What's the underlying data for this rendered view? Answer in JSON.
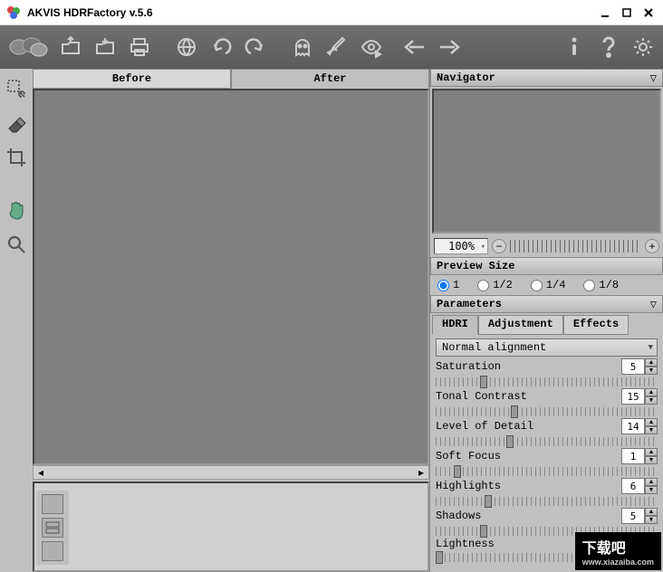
{
  "window": {
    "title": "AKVIS HDRFactory v.5.6"
  },
  "tabs": {
    "before": "Before",
    "after": "After"
  },
  "navigator": {
    "title": "Navigator",
    "zoom": "100%"
  },
  "preview": {
    "title": "Preview Size",
    "opts": {
      "o1": "1",
      "o2": "1/2",
      "o4": "1/4",
      "o8": "1/8"
    }
  },
  "parameters": {
    "title": "Parameters",
    "tabs": {
      "hdri": "HDRI",
      "adjustment": "Adjustment",
      "effects": "Effects"
    },
    "alignment": "Normal alignment",
    "rows": [
      {
        "label": "Saturation",
        "value": 5,
        "pos": 20
      },
      {
        "label": "Tonal Contrast",
        "value": 15,
        "pos": 34
      },
      {
        "label": "Level of Detail",
        "value": 14,
        "pos": 32
      },
      {
        "label": "Soft Focus",
        "value": 1,
        "pos": 8
      },
      {
        "label": "Highlights",
        "value": 6,
        "pos": 22
      },
      {
        "label": "Shadows",
        "value": 5,
        "pos": 20
      },
      {
        "label": "Lightness",
        "value": "",
        "pos": 0
      }
    ]
  },
  "watermark": {
    "main": "下载吧",
    "sub": "www.xiazaiba.com"
  }
}
